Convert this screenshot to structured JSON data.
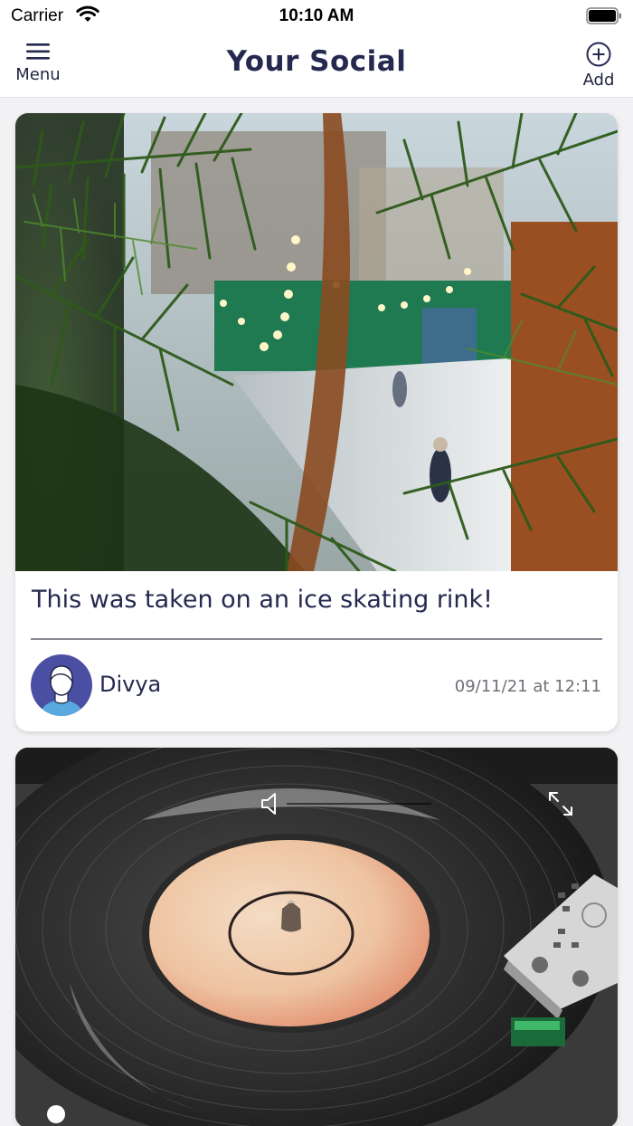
{
  "status_bar": {
    "carrier": "Carrier",
    "time": "10:10 AM",
    "icons": [
      "wifi-icon",
      "battery-icon"
    ]
  },
  "nav": {
    "menu_label": "Menu",
    "title": "Your Social",
    "add_label": "Add",
    "icons": [
      "hamburger-icon",
      "plus-circle-icon"
    ]
  },
  "posts": [
    {
      "type": "photo",
      "caption": "This was taken on an ice skating rink!",
      "author": "Divya",
      "timestamp": "09/11/21 at 12:11"
    },
    {
      "type": "video",
      "controls": [
        "mute-icon",
        "expand-icon"
      ]
    }
  ],
  "colors": {
    "title": "#252950",
    "text": "#1f2340",
    "background": "#f2f2f4",
    "card": "#ffffff",
    "avatar_bg": "#4a4fa3",
    "avatar_shirt": "#5aa8e0"
  }
}
